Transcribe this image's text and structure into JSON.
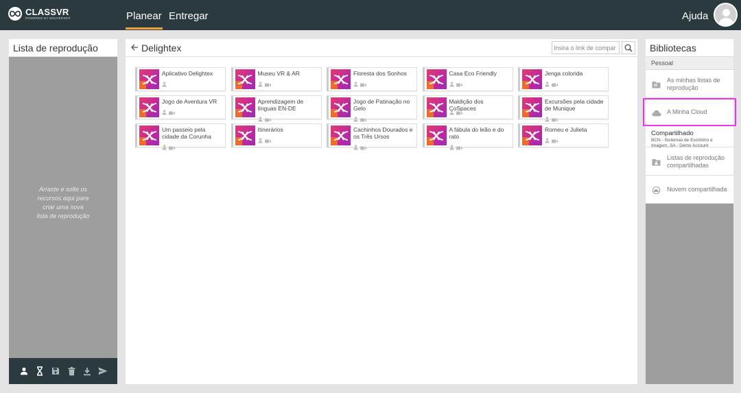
{
  "header": {
    "logo_title": "CLASSVR",
    "logo_sub": "POWERED BY EDUVERSE®",
    "tabs": [
      {
        "label": "Planear",
        "active": true
      },
      {
        "label": "Entregar",
        "active": false
      }
    ],
    "help_label": "Ajuda"
  },
  "left_panel": {
    "title": "Lista de reprodução",
    "drop_hint": "Arraste e solte os recursos aqui para criar uma nova lista de reprodução",
    "toolbar": [
      "user-icon",
      "hourglass-icon",
      "save-icon",
      "trash-icon",
      "download-icon",
      "send-icon"
    ]
  },
  "main": {
    "title": "Delightex",
    "search_placeholder": "Insira o link de compar",
    "items": [
      {
        "title": "Aplicativo Delightex",
        "icons": [
          "person"
        ]
      },
      {
        "title": "Museu VR & AR",
        "icons": [
          "person",
          "video"
        ]
      },
      {
        "title": "Floresta dos Sonhos",
        "icons": [
          "person",
          "video"
        ]
      },
      {
        "title": "Casa Eco Friendly",
        "icons": [
          "person",
          "video"
        ]
      },
      {
        "title": "Jenga colorida",
        "icons": [
          "person",
          "video"
        ]
      },
      {
        "title": "Jogo de Aventura VR",
        "icons": [
          "person",
          "video"
        ]
      },
      {
        "title": "Aprendizagem de línguas EN-DE",
        "icons": [
          "person",
          "video"
        ]
      },
      {
        "title": "Jogo de Patinação no Gelo",
        "icons": [
          "person",
          "video"
        ]
      },
      {
        "title": "Maldição dos CoSpaces",
        "icons": [
          "person",
          "video"
        ]
      },
      {
        "title": "Excursões pela cidade de Munique",
        "icons": [
          "person",
          "video"
        ]
      },
      {
        "title": "Um passeio pela cidade da Corunha",
        "icons": [
          "person",
          "video"
        ]
      },
      {
        "title": "Itinerários",
        "icons": [
          "person",
          "video"
        ]
      },
      {
        "title": "Cachinhos Dourados e os Três Ursos",
        "icons": [
          "person",
          "video"
        ]
      },
      {
        "title": "A fábula do leão e do rato",
        "icons": [
          "person",
          "video"
        ]
      },
      {
        "title": "Romeu e Julieta",
        "icons": [
          "person",
          "video"
        ]
      }
    ]
  },
  "libraries": {
    "title": "Bibliotecas",
    "personal_label": "Pessoal",
    "personal_items": [
      {
        "label": "As minhas listas de reprodução",
        "icon": "playlist-folder-icon"
      },
      {
        "label": "A Minha Cloud",
        "icon": "cloud-icon"
      }
    ],
    "shared_title": "Compartilhado",
    "shared_sub": "BCN - Sistemas de Escritório e Imagem, SA - Demo Account",
    "shared_items": [
      {
        "label": "Listas de reprodução compartilhadas",
        "icon": "shared-folder-icon"
      },
      {
        "label": "Nuvem compartilhada",
        "icon": "shared-cloud-icon"
      }
    ],
    "highlight_color": "#ee33ee"
  }
}
